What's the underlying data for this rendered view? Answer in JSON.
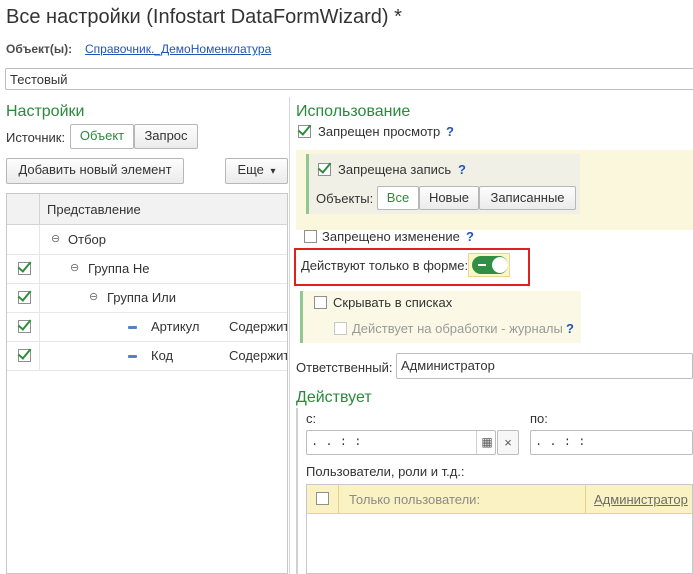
{
  "window": {
    "title": "Все настройки (Infostart DataFormWizard) *"
  },
  "object": {
    "label": "Объект(ы):",
    "link": "Справочник._ДемоНоменклатура"
  },
  "name_field": {
    "value": "Тестовый"
  },
  "settings": {
    "title": "Настройки",
    "source_label": "Источник:",
    "source_options": [
      "Объект",
      "Запрос"
    ],
    "selected_source": "Объект",
    "add_button": "Добавить новый элемент",
    "more_button": "Еще",
    "more_chevron": "▾",
    "grid": {
      "column_header": "Представление",
      "rows": [
        {
          "checked": false,
          "icon": "tree-collapse-icon",
          "label": "Отбор",
          "value": ""
        },
        {
          "checked": true,
          "icon": "tree-collapse-icon",
          "label": "Группа Не",
          "value": ""
        },
        {
          "checked": true,
          "icon": "tree-collapse-icon",
          "label": "Группа Или",
          "value": ""
        },
        {
          "checked": true,
          "icon": "field-icon",
          "label": "Артикул",
          "value": "Содержит"
        },
        {
          "checked": true,
          "icon": "field-icon",
          "label": "Код",
          "value": "Содержит"
        }
      ]
    }
  },
  "usage": {
    "title": "Использование",
    "deny_view": {
      "label": "Запрещен просмотр",
      "checked": true,
      "help": "?"
    },
    "deny_write": {
      "label": "Запрещена запись",
      "checked": true,
      "help": "?"
    },
    "objects_label": "Объекты:",
    "objects_options": [
      "Все",
      "Новые",
      "Записанные"
    ],
    "objects_selected": "Все",
    "deny_change": {
      "label": "Запрещено изменение",
      "checked": false,
      "help": "?"
    },
    "form_only": {
      "label": "Действуют только в форме:",
      "on": true
    },
    "hide_in_lists": {
      "label": "Скрывать в списках",
      "checked": false
    },
    "apply_processing": {
      "label": "Действует на обработки - журналы",
      "checked": false,
      "help": "?"
    },
    "responsible_label": "Ответственный:",
    "responsible_value": "Администратор"
  },
  "acts": {
    "title": "Действует",
    "from_label": "с:",
    "to_label": "по:",
    "from_value": "  .  .       :  :  ",
    "to_value": "  .  .       :  :  ",
    "calendar_icon": "calendar-icon",
    "clear_icon": "×",
    "users_label": "Пользователи, роли и т.д.:",
    "users_table": {
      "header_col1": "Только пользователи:",
      "header_col2": "Администратор",
      "checked": false
    }
  },
  "colors": {
    "accent": "#2a8a3c",
    "highlight_border": "#e0201c",
    "link": "#2254b4",
    "note_bg": "#fbf7dc"
  }
}
